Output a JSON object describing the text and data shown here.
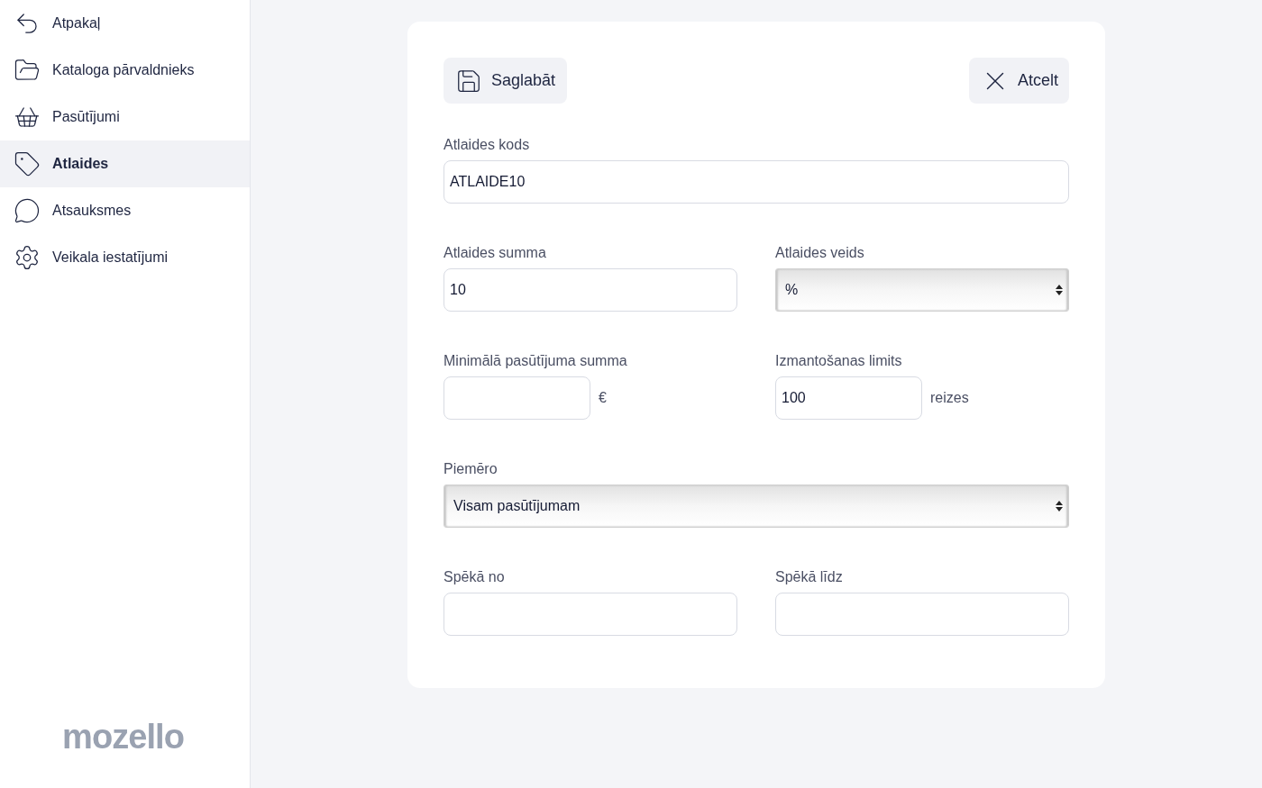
{
  "sidebar": {
    "items": [
      {
        "label": "Atpakaļ",
        "selected": false
      },
      {
        "label": "Kataloga pārvaldnieks",
        "selected": false
      },
      {
        "label": "Pasūtījumi",
        "selected": false
      },
      {
        "label": "Atlaides",
        "selected": true
      },
      {
        "label": "Atsauksmes",
        "selected": false
      },
      {
        "label": "Veikala iestatījumi",
        "selected": false
      }
    ],
    "logo": "mozello"
  },
  "toolbar": {
    "save": "Saglabāt",
    "cancel": "Atcelt"
  },
  "rows": [
    [
      {
        "label": "Atlaides kods",
        "kind": "text",
        "value": "ATLAIDE10"
      }
    ],
    [
      {
        "label": "Atlaides summa",
        "kind": "text",
        "value": "10"
      },
      {
        "label": "Atlaides veids",
        "kind": "select",
        "value": "%"
      }
    ],
    [
      {
        "label": "Minimālā pasūtījuma summa",
        "kind": "short",
        "suffix": "€"
      },
      {
        "label": "Izmantošanas limits",
        "kind": "short",
        "value": "100",
        "suffix": "reizes"
      }
    ],
    [
      {
        "label": "Piemēro",
        "kind": "select",
        "value": "Visam pasūtījumam"
      }
    ],
    [
      {
        "label": "Spēkā no",
        "kind": "text"
      },
      {
        "label": "Spēkā līdz",
        "kind": "text"
      }
    ]
  ]
}
